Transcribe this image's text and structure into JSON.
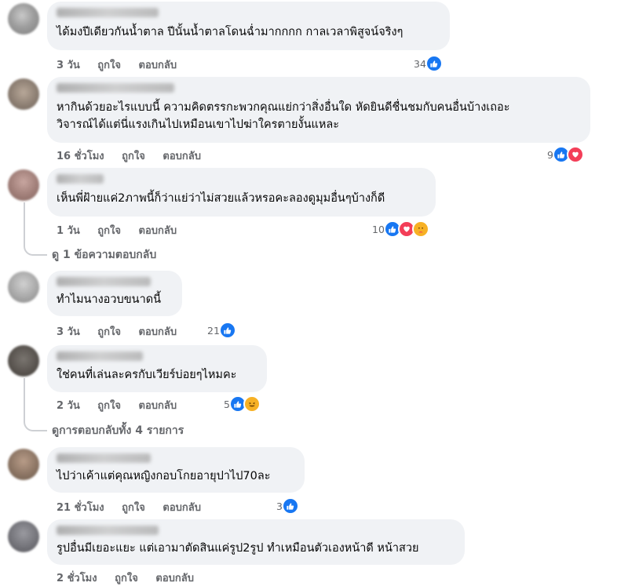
{
  "actions": {
    "like": "ถูกใจ",
    "reply": "ตอบกลับ"
  },
  "colors": {
    "like": "#1877f2",
    "love": "#f33e58",
    "haha": "#f7b125",
    "bubble": "#f0f2f5",
    "meta": "#65676b"
  },
  "comments": [
    {
      "text_lines": [
        "ได้มงปีเดียวกันน้ำตาล ปีนั้นน้ำตาลโดนฉ่ำมากกกก กาลเวลาพิสูจน์จริงๆ"
      ],
      "time": "3 วัน",
      "reaction_count": "34",
      "reactions": [
        "like-icon"
      ]
    },
    {
      "text_lines": [
        "หากินด้วยอะไรแบบนี้ ความคิดตรรกะพวกคุณแย่กว่าสิ่งอื่นใด หัดยินดีชื่นชมกับคนอื่นบ้างเถอะ",
        "วิจารณ์ได้แต่นี่แรงเกินไปเหมือนเขาไปฆ่าใครตายงั้นแหละ"
      ],
      "time": "16 ชั่วโมง",
      "reaction_count": "9",
      "reactions": [
        "like-icon",
        "love-icon"
      ]
    },
    {
      "text_lines": [
        "เห็นพี่ฝ้ายแค่2ภาพนี้ก็ว่าแย่ว่าไม่สวยแล้วหรอคะลองดูมุมอื่นๆบ้างก็ดี"
      ],
      "time": "1 วัน",
      "reaction_count": "10",
      "reactions": [
        "like-icon",
        "love-icon",
        "care-icon"
      ],
      "view_replies": "ดู 1 ข้อความตอบกลับ"
    },
    {
      "text_lines": [
        "ทำไมนางอวบขนาดนี้"
      ],
      "time": "3 วัน",
      "reaction_count": "21",
      "reactions": [
        "like-icon"
      ]
    },
    {
      "text_lines": [
        "ใช่คนที่เล่นละครกับเวียร์บ่อยๆไหมคะ"
      ],
      "time": "2 วัน",
      "reaction_count": "5",
      "reactions": [
        "like-icon",
        "haha-icon"
      ],
      "view_replies": "ดูการตอบกลับทั้ง 4 รายการ"
    },
    {
      "text_lines": [
        "ไปว่าเค้าแต่คุณหญิงกอบโกยอายุปาไป70ละ"
      ],
      "time": "21 ชั่วโมง",
      "reaction_count": "3",
      "reactions": [
        "like-icon"
      ]
    },
    {
      "text_lines": [
        "รูปอื่นมีเยอะแยะ แต่เอามาตัดสินแค่รูป2รูป ทำเหมือนตัวเองหน้าดี หน้าสวย"
      ],
      "time": "2 ชั่วโมง",
      "reaction_count": "",
      "reactions": []
    }
  ]
}
